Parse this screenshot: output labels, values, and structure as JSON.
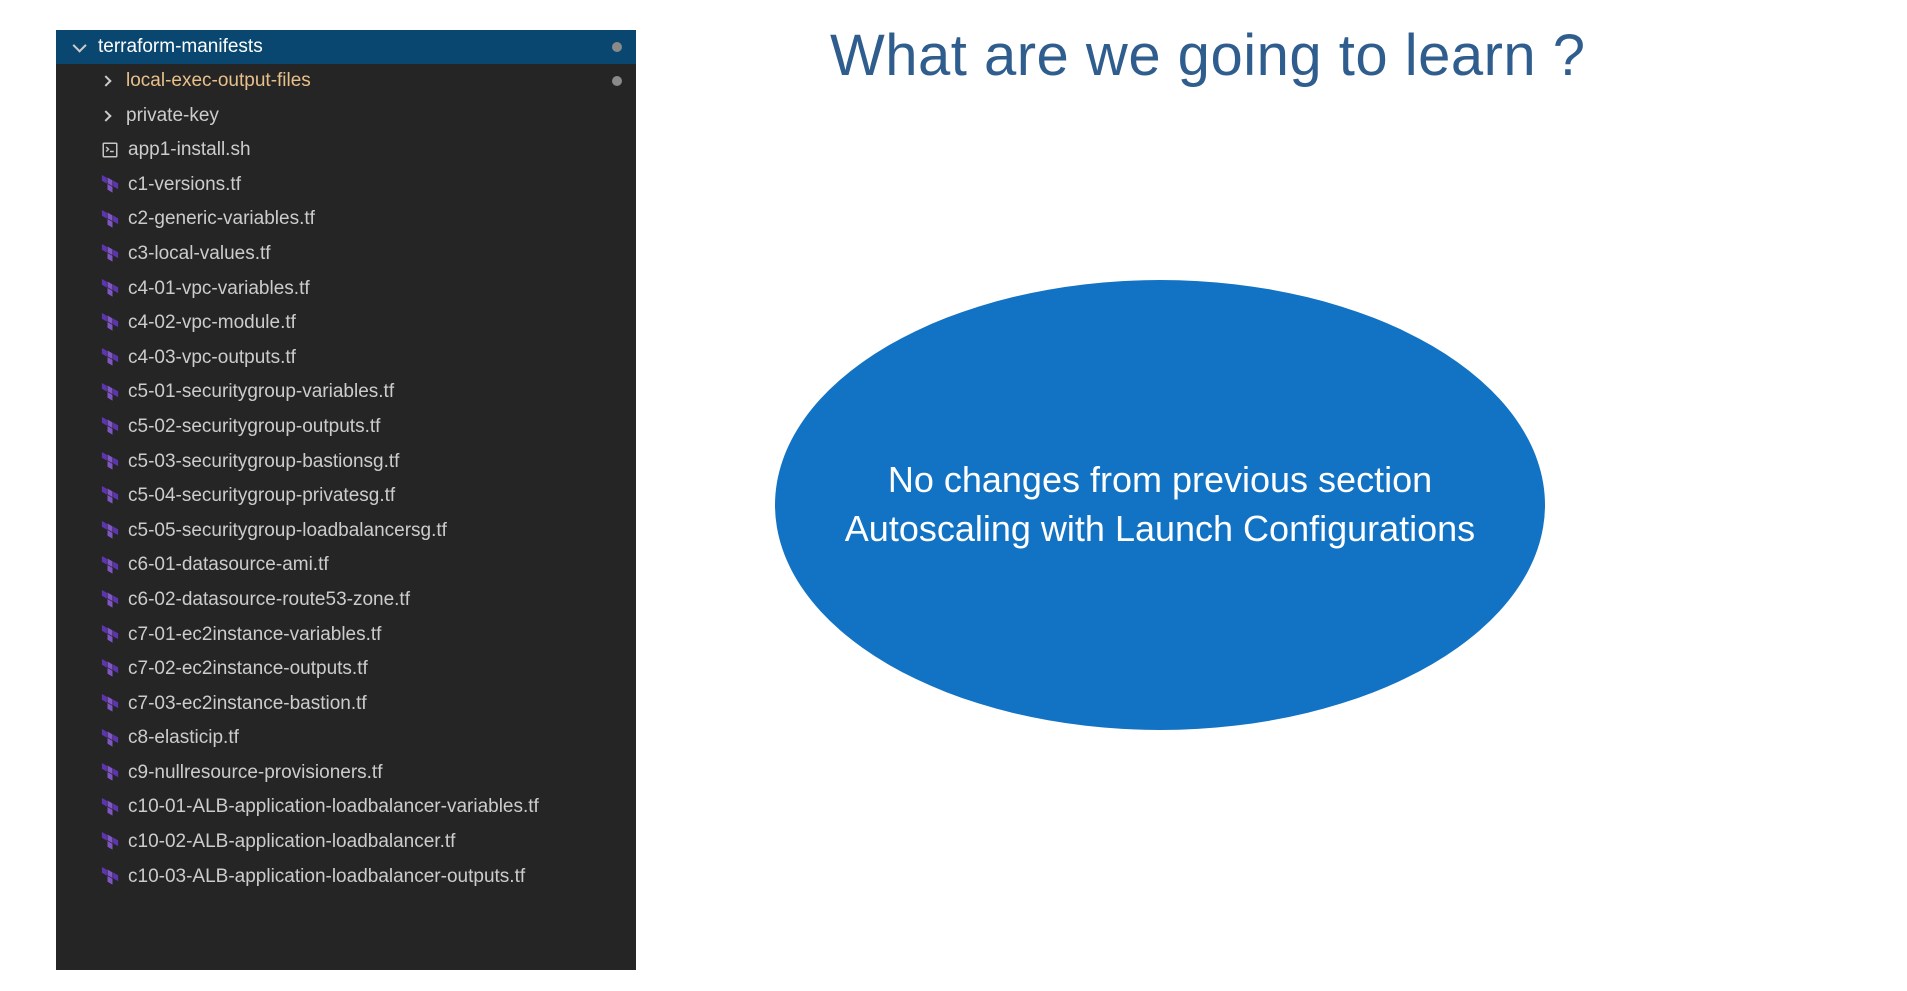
{
  "explorer": {
    "root_folder": "terraform-manifests",
    "subfolders": [
      {
        "name": "local-exec-output-files",
        "highlight": true,
        "modified_dot": true
      },
      {
        "name": "private-key",
        "highlight": false,
        "modified_dot": false
      }
    ],
    "files": [
      {
        "name": "app1-install.sh",
        "type": "sh"
      },
      {
        "name": "c1-versions.tf",
        "type": "tf"
      },
      {
        "name": "c2-generic-variables.tf",
        "type": "tf"
      },
      {
        "name": "c3-local-values.tf",
        "type": "tf"
      },
      {
        "name": "c4-01-vpc-variables.tf",
        "type": "tf"
      },
      {
        "name": "c4-02-vpc-module.tf",
        "type": "tf"
      },
      {
        "name": "c4-03-vpc-outputs.tf",
        "type": "tf"
      },
      {
        "name": "c5-01-securitygroup-variables.tf",
        "type": "tf"
      },
      {
        "name": "c5-02-securitygroup-outputs.tf",
        "type": "tf"
      },
      {
        "name": "c5-03-securitygroup-bastionsg.tf",
        "type": "tf"
      },
      {
        "name": "c5-04-securitygroup-privatesg.tf",
        "type": "tf"
      },
      {
        "name": "c5-05-securitygroup-loadbalancersg.tf",
        "type": "tf"
      },
      {
        "name": "c6-01-datasource-ami.tf",
        "type": "tf"
      },
      {
        "name": "c6-02-datasource-route53-zone.tf",
        "type": "tf"
      },
      {
        "name": "c7-01-ec2instance-variables.tf",
        "type": "tf"
      },
      {
        "name": "c7-02-ec2instance-outputs.tf",
        "type": "tf"
      },
      {
        "name": "c7-03-ec2instance-bastion.tf",
        "type": "tf"
      },
      {
        "name": "c8-elasticip.tf",
        "type": "tf"
      },
      {
        "name": "c9-nullresource-provisioners.tf",
        "type": "tf"
      },
      {
        "name": "c10-01-ALB-application-loadbalancer-variables.tf",
        "type": "tf"
      },
      {
        "name": "c10-02-ALB-application-loadbalancer.tf",
        "type": "tf"
      },
      {
        "name": "c10-03-ALB-application-loadbalancer-outputs.tf",
        "type": "tf"
      }
    ]
  },
  "heading": "What are we going to learn ?",
  "ellipse_line1": "No changes from previous section",
  "ellipse_line2": "Autoscaling with Launch Configurations"
}
